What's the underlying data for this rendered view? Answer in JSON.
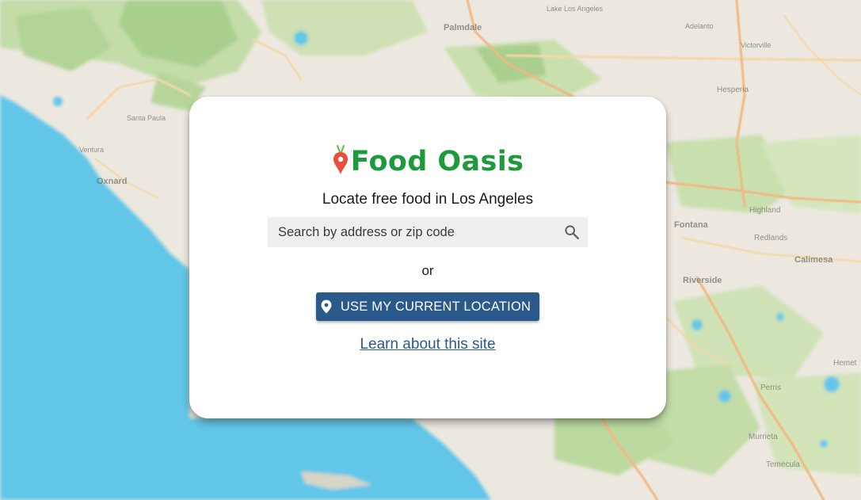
{
  "map": {
    "place_labels": [
      "Palmdale",
      "Lake Los Angeles",
      "Adelanto",
      "Victorville",
      "Hesperia",
      "Santa Paula",
      "Ventura",
      "Oxnard",
      "Fontana",
      "Highland",
      "Redlands",
      "Calimesa",
      "Riverside",
      "Perris",
      "Murrieta",
      "Temecula",
      "Hemet"
    ],
    "colors": {
      "ocean": "#62c6e8",
      "land": "#ece8e0",
      "green": "#b6d69c",
      "road": "#f2b884"
    }
  },
  "logo": {
    "text": "Food Oasis",
    "color": "#1d9a3c",
    "pin_color": "#e8503b",
    "leaf_color": "#6cb443",
    "icon": "carrot-pin-icon"
  },
  "tagline": "Locate free food in Los Angeles",
  "search": {
    "placeholder": "Search by address or zip code",
    "value": "",
    "icon": "search-icon"
  },
  "or_text": "or",
  "location_button": {
    "label": "USE MY CURRENT LOCATION",
    "icon": "location-pin-icon",
    "color": "#2a5a8c"
  },
  "learn_link": "Learn about this site"
}
